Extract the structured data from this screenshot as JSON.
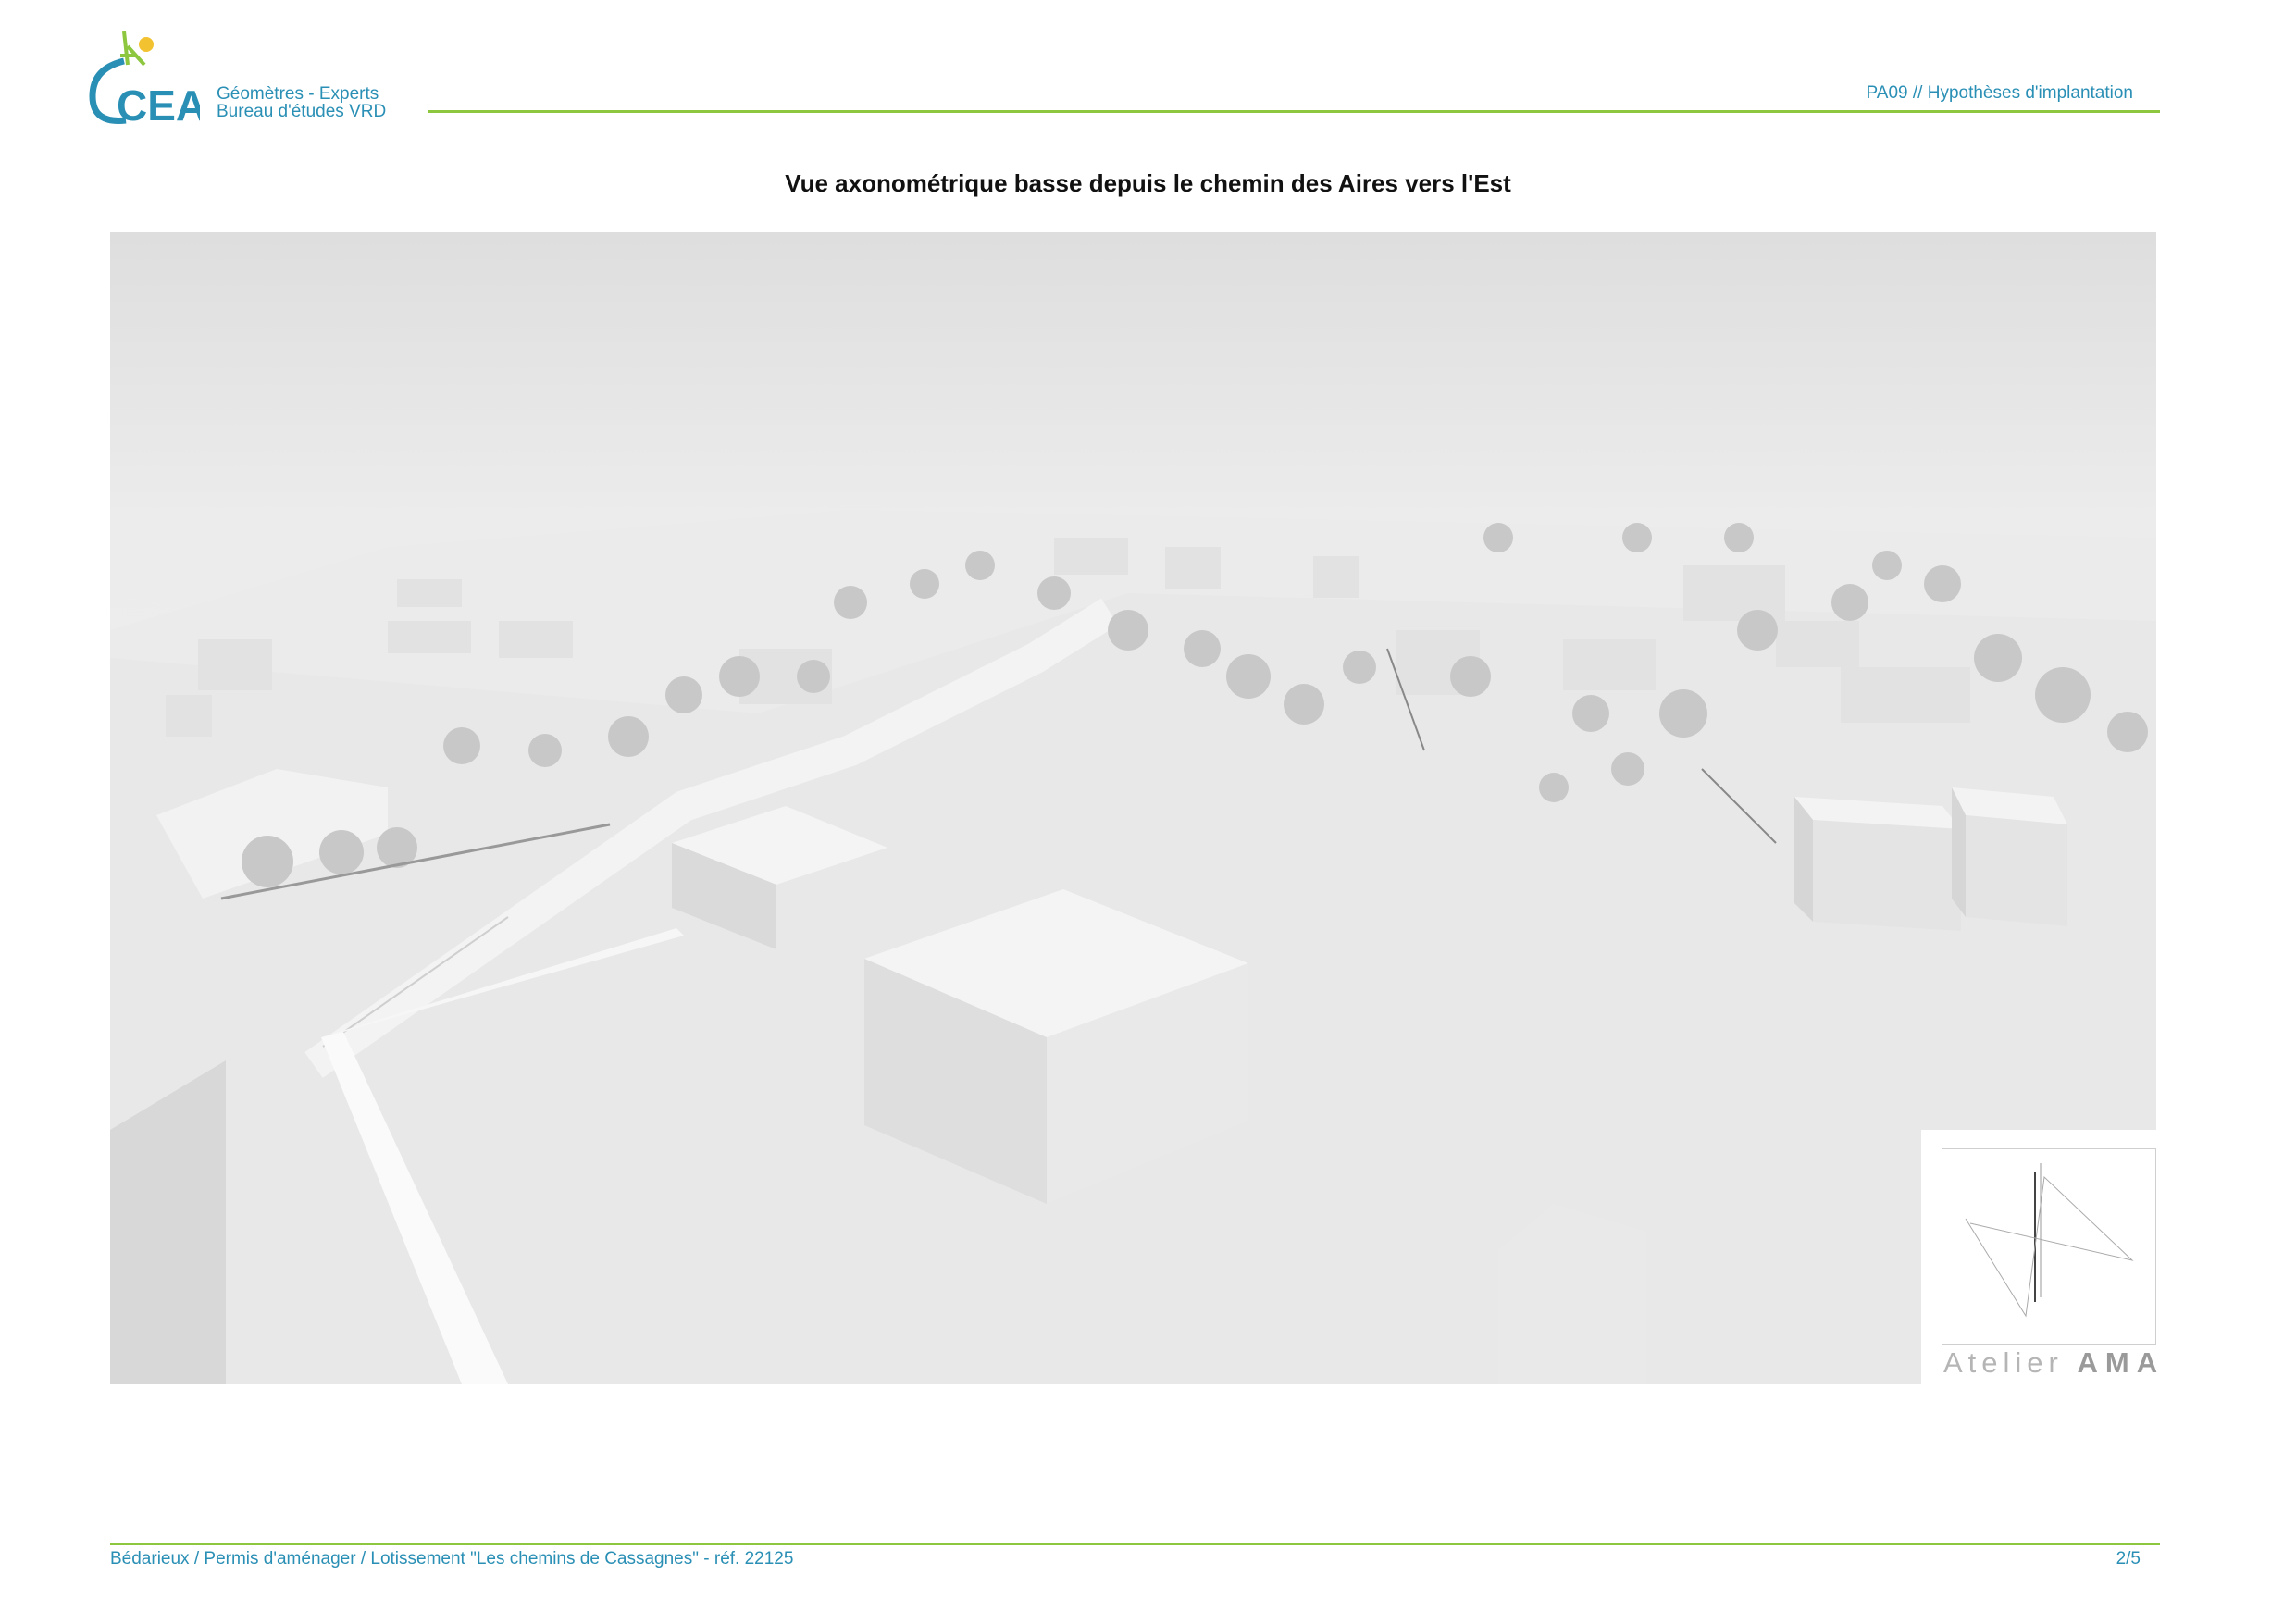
{
  "header": {
    "logo_text": "CEAU",
    "tagline_line1": "Géomètres - Experts",
    "tagline_line2": "Bureau d'études VRD",
    "document_ref": "PA09 // Hypothèses d'implantation"
  },
  "title": "Vue axonométrique basse depuis le chemin des Aires vers l'Est",
  "render": {
    "stamp_brand": "Atelier",
    "stamp_brand_bold": "AMA"
  },
  "footer": {
    "project": "Bédarieux / Permis d'aménager / Lotissement \"Les chemins de Cassagnes\" - réf. 22125",
    "page": "2/5"
  },
  "colors": {
    "accent_green": "#8dc63f",
    "brand_blue": "#2a8fb5"
  }
}
